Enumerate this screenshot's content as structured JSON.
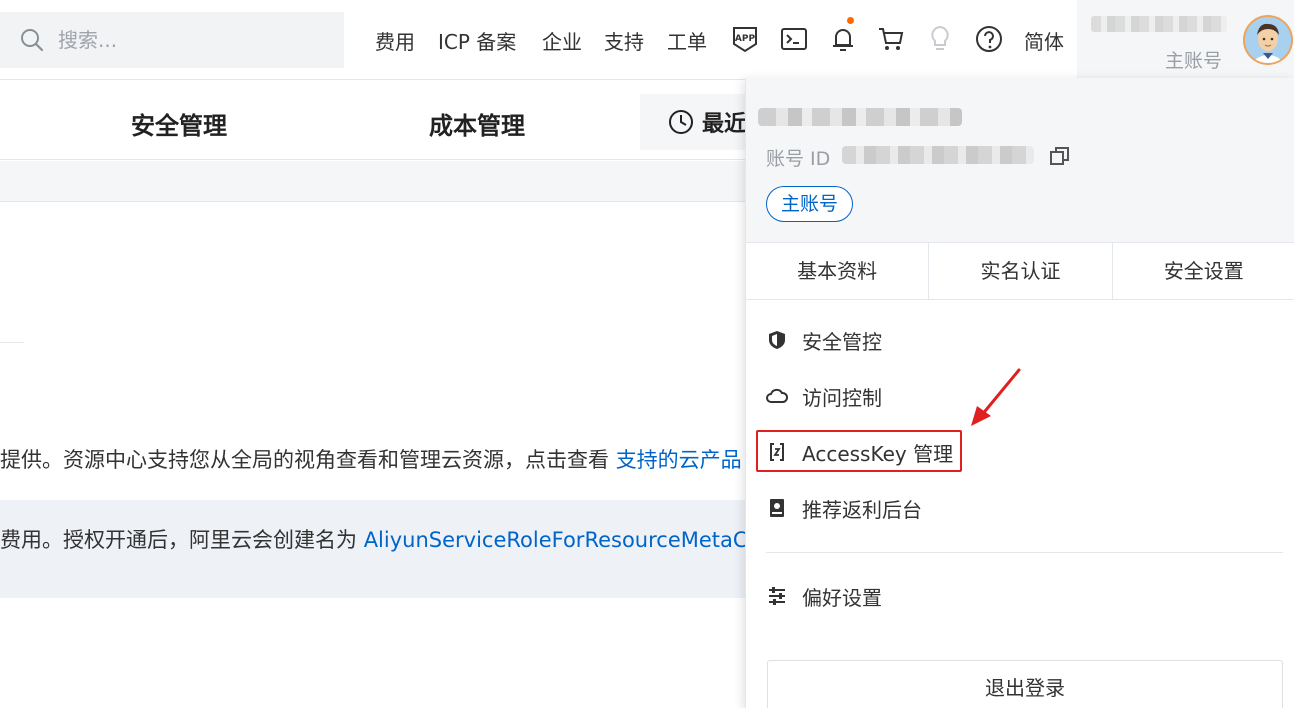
{
  "search": {
    "placeholder": "搜索..."
  },
  "topnav": {
    "links": [
      "费用",
      "ICP 备案",
      "企业",
      "支持",
      "工单"
    ],
    "lang": "简体",
    "app_icon_text": "APP"
  },
  "account": {
    "role": "主账号"
  },
  "tabs": {
    "security": "安全管理",
    "cost": "成本管理",
    "recent": "最近"
  },
  "content": {
    "desc_prefix": "提供。资源中心支持您从全局的视角查看和管理云资源，点击查看 ",
    "desc_link": "支持的云产品",
    "notice_prefix": "费用。授权开通后，阿里云会创建名为 ",
    "notice_link": "AliyunServiceRoleForResourceMetaCente"
  },
  "dropdown": {
    "id_label": "账号 ID",
    "role_pill": "主账号",
    "tabs": [
      "基本资料",
      "实名认证",
      "安全设置"
    ],
    "menu": [
      {
        "label": "安全管控",
        "icon": "shield-icon"
      },
      {
        "label": "访问控制",
        "icon": "cloud-icon"
      },
      {
        "label": "AccessKey 管理",
        "icon": "key-bracket-icon"
      },
      {
        "label": "推荐返利后台",
        "icon": "contact-card-icon"
      },
      {
        "label": "偏好设置",
        "icon": "sliders-icon"
      }
    ],
    "logout": "退出登录"
  },
  "colors": {
    "accent": "#0064c8",
    "notification_dot": "#ff6a00",
    "highlight": "#e02020"
  }
}
